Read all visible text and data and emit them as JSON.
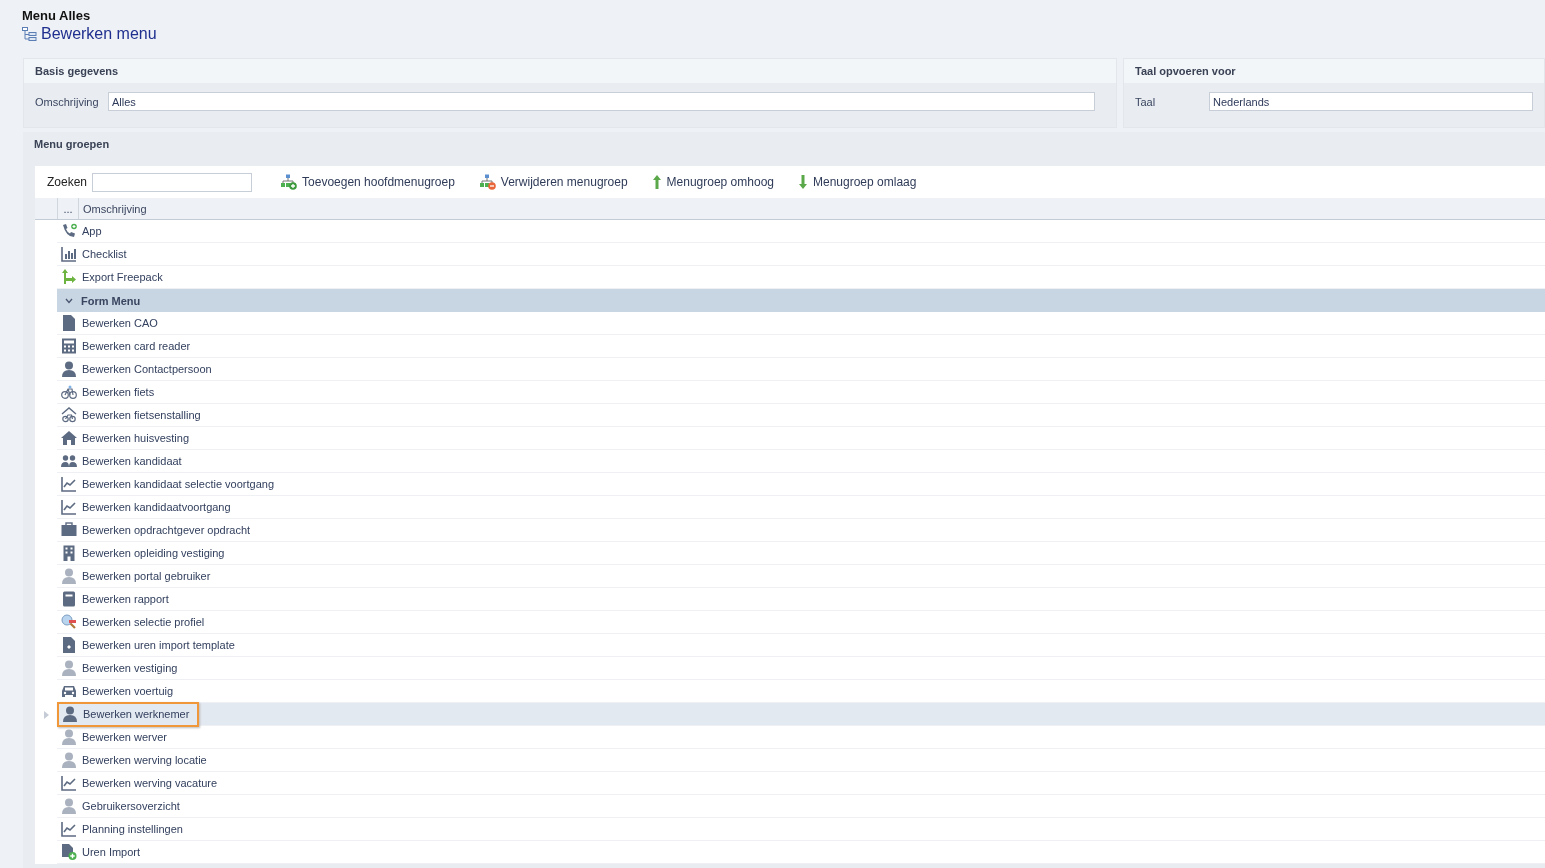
{
  "header": {
    "title": "Menu Alles",
    "subtitle": "Bewerken menu"
  },
  "basis": {
    "heading": "Basis gegevens",
    "fields": [
      {
        "label": "Omschrijving",
        "value": "Alles"
      }
    ]
  },
  "taal": {
    "heading": "Taal opvoeren voor",
    "fields": [
      {
        "label": "Taal",
        "value": "Nederlands"
      }
    ]
  },
  "menu_groepen": {
    "heading": "Menu groepen",
    "search": {
      "label": "Zoeken"
    },
    "toolbar": [
      {
        "label": "Toevoegen hoofdmenugroep",
        "kind": "add"
      },
      {
        "label": "Verwijderen menugroep",
        "kind": "remove"
      },
      {
        "label": "Menugroep omhoog",
        "kind": "up"
      },
      {
        "label": "Menugroep omlaag",
        "kind": "down"
      }
    ],
    "columns": [
      "...",
      "Omschrijving"
    ],
    "rows": [
      {
        "kind": "phone",
        "label": "App",
        "selected": false
      },
      {
        "kind": "bars",
        "label": "Checklist",
        "selected": false
      },
      {
        "kind": "export",
        "label": "Export Freepack",
        "selected": false
      },
      {
        "kind": "group",
        "label": "Form Menu",
        "expanded": true,
        "selected": false,
        "children": [
          {
            "kind": "document",
            "label": "Bewerken CAO",
            "selected": false
          },
          {
            "kind": "calculator",
            "label": "Bewerken card reader",
            "selected": false
          },
          {
            "kind": "person",
            "label": "Bewerken Contactpersoon",
            "selected": false
          },
          {
            "kind": "bicycle",
            "label": "Bewerken fiets",
            "selected": false
          },
          {
            "kind": "bikeshed",
            "label": "Bewerken fietsenstalling",
            "selected": false
          },
          {
            "kind": "house",
            "label": "Bewerken huisvesting",
            "selected": false
          },
          {
            "kind": "people",
            "label": "Bewerken kandidaat",
            "selected": false
          },
          {
            "kind": "trend",
            "label": "Bewerken kandidaat selectie voortgang",
            "selected": false
          },
          {
            "kind": "trend",
            "label": "Bewerken kandidaatvoortgang",
            "selected": false
          },
          {
            "kind": "briefcase",
            "label": "Bewerken opdrachtgever opdracht",
            "selected": false
          },
          {
            "kind": "building",
            "label": "Bewerken opleiding vestiging",
            "selected": false
          },
          {
            "kind": "personlight",
            "label": "Bewerken portal gebruiker",
            "selected": false
          },
          {
            "kind": "notebook",
            "label": "Bewerken rapport",
            "selected": false
          },
          {
            "kind": "magnifier",
            "label": "Bewerken selectie profiel",
            "selected": false
          },
          {
            "kind": "file",
            "label": "Bewerken uren import template",
            "selected": false
          },
          {
            "kind": "personlight",
            "label": "Bewerken vestiging",
            "selected": false
          },
          {
            "kind": "car",
            "label": "Bewerken voertuig",
            "selected": false
          },
          {
            "kind": "person",
            "label": "Bewerken werknemer",
            "selected": true
          },
          {
            "kind": "personlight",
            "label": "Bewerken werver",
            "selected": false
          },
          {
            "kind": "personlight",
            "label": "Bewerken werving locatie",
            "selected": false
          },
          {
            "kind": "trend",
            "label": "Bewerken werving vacature",
            "selected": false
          },
          {
            "kind": "personlight",
            "label": "Gebruikersoverzicht",
            "selected": false
          },
          {
            "kind": "trend",
            "label": "Planning instellingen",
            "selected": false
          },
          {
            "kind": "fileplus",
            "label": "Uren Import",
            "selected": false
          }
        ]
      }
    ]
  }
}
